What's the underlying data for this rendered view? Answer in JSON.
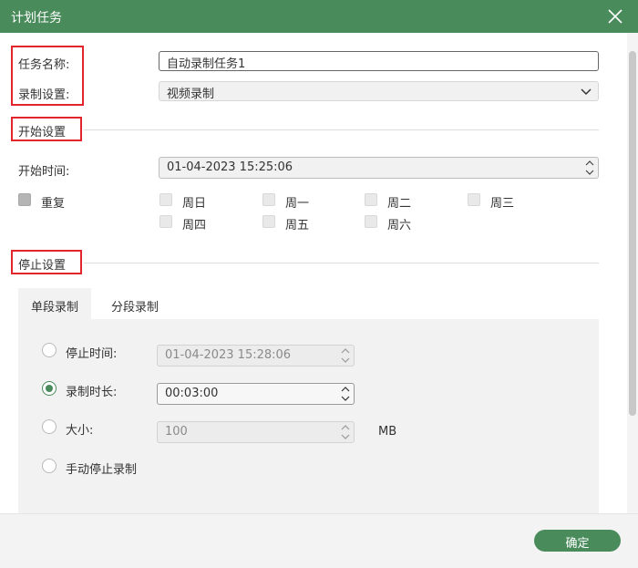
{
  "window": {
    "title": "计划任务"
  },
  "task": {
    "name_label": "任务名称:",
    "name_value": "自动录制任务1",
    "record_label": "录制设置:",
    "record_value": "视频录制"
  },
  "start": {
    "section_title": "开始设置",
    "time_label": "开始时间:",
    "time_value": "01-04-2023 15:25:06",
    "repeat_label": "重复",
    "days": [
      "周日",
      "周一",
      "周二",
      "周三",
      "周四",
      "周五",
      "周六"
    ]
  },
  "stop": {
    "section_title": "停止设置",
    "tabs": [
      "单段录制",
      "分段录制"
    ],
    "stop_time_label": "停止时间:",
    "stop_time_value": "01-04-2023 15:28:06",
    "duration_label": "录制时长:",
    "duration_value": "00:03:00",
    "size_label": "大小:",
    "size_value": "100",
    "size_unit": "MB",
    "manual_label": "手动停止录制"
  },
  "footer": {
    "ok_label": "确定"
  },
  "colors": {
    "accent": "#4a8b5c",
    "highlight": "#e3262b"
  }
}
